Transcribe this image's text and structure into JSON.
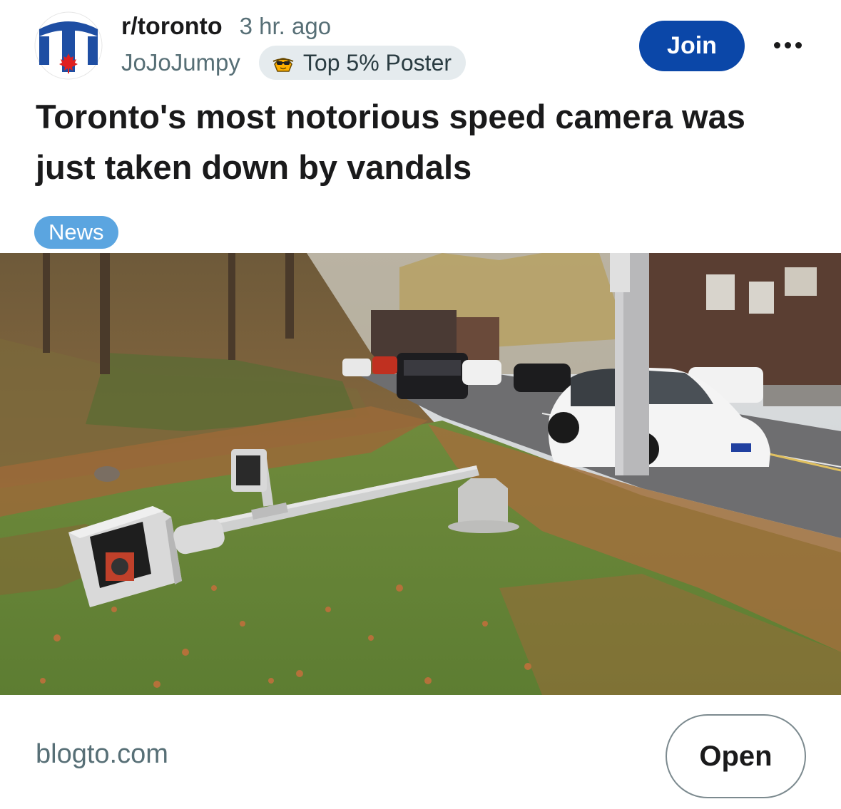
{
  "post": {
    "subreddit": "r/toronto",
    "time_ago": "3 hr. ago",
    "author": "JoJoJumpy",
    "author_flair": "Top 5% Poster",
    "join_label": "Join",
    "title": "Toronto's most notorious speed camera was just taken down by vandals",
    "tag": "News",
    "link_domain": "blogto.com",
    "open_label": "Open"
  },
  "colors": {
    "join_button": "#0b47a8",
    "news_tag": "#5ba5e0",
    "flair_background": "#e5ebee",
    "meta_text": "#576f76"
  },
  "icons": {
    "subreddit_avatar": "toronto-t-logo-with-maple-leaf",
    "flair": "sunglasses-face-icon",
    "more": "ellipsis-icon"
  }
}
